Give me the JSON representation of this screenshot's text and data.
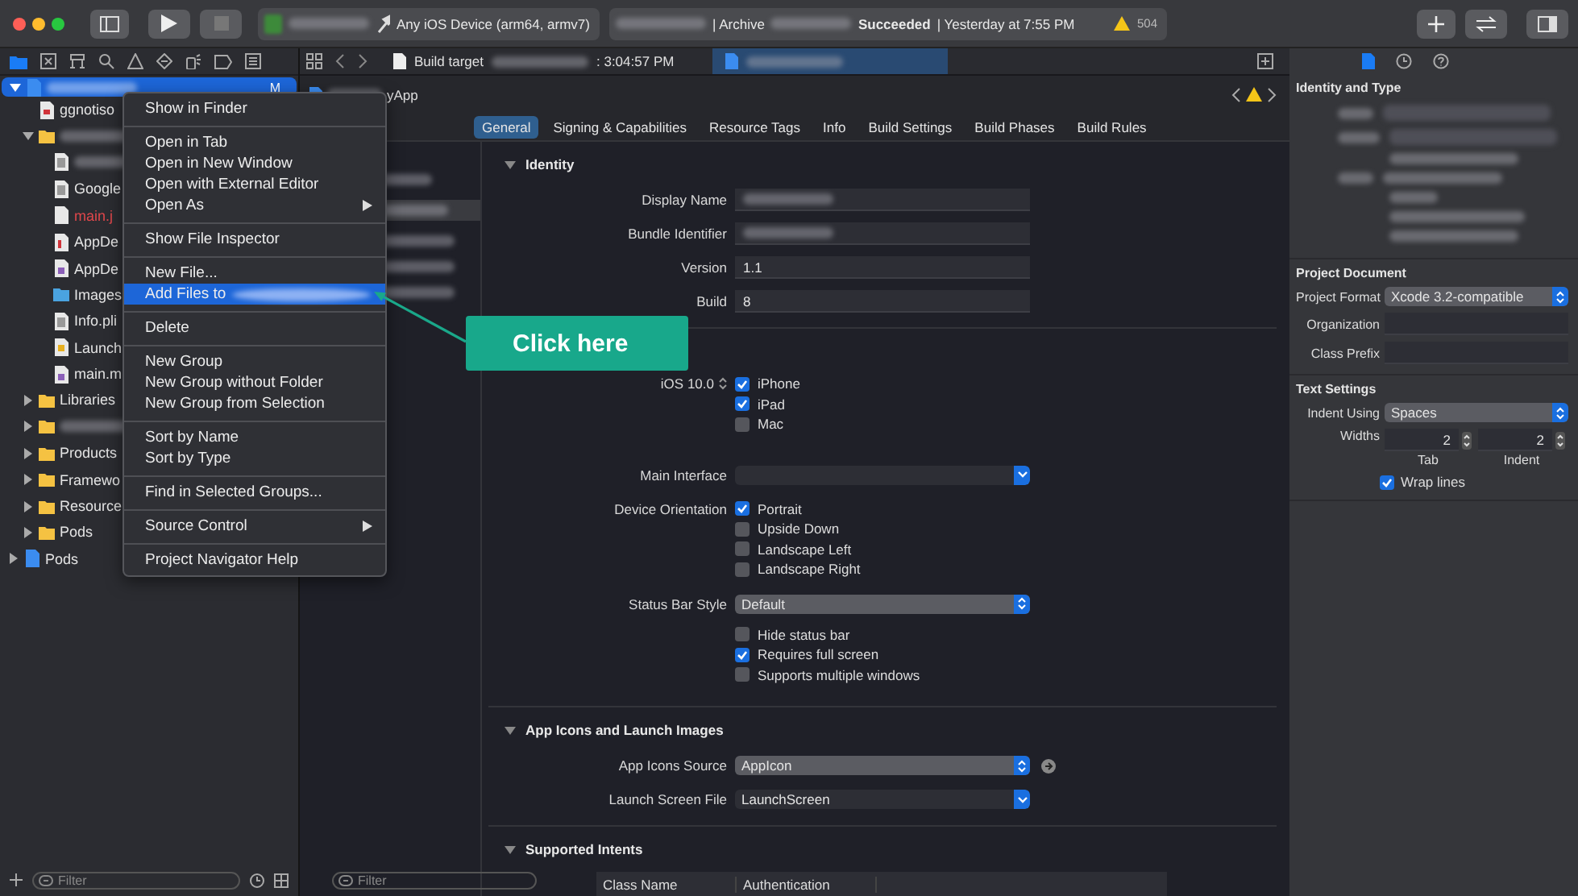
{
  "toolbar": {
    "device": "Any iOS Device (arm64, armv7)",
    "action": "| Archive",
    "status": "Succeeded",
    "time": "| Yesterday at 7:55 PM",
    "warnings": "504"
  },
  "navigator": {
    "tree": [
      {
        "blurred": true,
        "kind": "project",
        "expanded": true,
        "selected": true,
        "missing": false,
        "badge": "M",
        "children": [
          {
            "name": "ggnotiso",
            "kind": "file",
            "selected": false,
            "missing": false
          },
          {
            "blurred": true,
            "kind": "folder",
            "expanded": true,
            "selected": false,
            "missing": false,
            "children": [
              {
                "blurred": true,
                "kind": "plist",
                "selected": false,
                "missing": false
              },
              {
                "name": "Google",
                "kind": "plist",
                "selected": false,
                "missing": false
              },
              {
                "name": "main.j",
                "kind": "file",
                "selected": false,
                "missing": true
              },
              {
                "name": "AppDe",
                "kind": "header",
                "selected": false,
                "missing": false
              },
              {
                "name": "AppDe",
                "kind": "impl",
                "selected": false,
                "missing": false
              },
              {
                "name": "Images",
                "kind": "assets",
                "selected": false,
                "missing": false
              },
              {
                "name": "Info.pli",
                "kind": "plist",
                "selected": false,
                "missing": false
              },
              {
                "name": "Launch",
                "kind": "storyboard",
                "selected": false,
                "missing": false
              },
              {
                "name": "main.m",
                "kind": "impl",
                "selected": false,
                "missing": false
              }
            ]
          },
          {
            "name": "Libraries",
            "kind": "folder",
            "expanded": false,
            "selected": false,
            "missing": false
          },
          {
            "blurred": true,
            "kind": "folder",
            "expanded": false,
            "selected": false,
            "missing": false
          },
          {
            "name": "Products",
            "kind": "folder",
            "expanded": false,
            "selected": false,
            "missing": false
          },
          {
            "name": "Framewo",
            "kind": "folder",
            "expanded": false,
            "selected": false,
            "missing": false
          },
          {
            "name": "Resource",
            "kind": "folder",
            "expanded": false,
            "selected": false,
            "missing": false
          },
          {
            "name": "Pods",
            "kind": "folder",
            "expanded": false,
            "selected": false,
            "missing": false
          }
        ]
      },
      {
        "name": "Pods",
        "kind": "project",
        "expanded": false,
        "selected": false,
        "missing": false
      }
    ],
    "filter_placeholder": "Filter"
  },
  "context_menu": {
    "sections": [
      [
        {
          "label": "Show in Finder",
          "selected": false,
          "submenu": false
        }
      ],
      [
        {
          "label": "Open in Tab",
          "selected": false,
          "submenu": false
        },
        {
          "label": "Open in New Window",
          "selected": false,
          "submenu": false
        },
        {
          "label": "Open with External Editor",
          "selected": false,
          "submenu": false
        },
        {
          "label": "Open As",
          "selected": false,
          "submenu": true
        }
      ],
      [
        {
          "label": "Show File Inspector",
          "selected": false,
          "submenu": false
        }
      ],
      [
        {
          "label": "New File...",
          "selected": false,
          "submenu": false
        },
        {
          "label": "Add Files to",
          "blurred_suffix": true,
          "selected": true,
          "submenu": false
        }
      ],
      [
        {
          "label": "Delete",
          "selected": false,
          "submenu": false
        }
      ],
      [
        {
          "label": "New Group",
          "selected": false,
          "submenu": false
        },
        {
          "label": "New Group without Folder",
          "selected": false,
          "submenu": false
        },
        {
          "label": "New Group from Selection",
          "selected": false,
          "submenu": false
        }
      ],
      [
        {
          "label": "Sort by Name",
          "selected": false,
          "submenu": false
        },
        {
          "label": "Sort by Type",
          "selected": false,
          "submenu": false
        }
      ],
      [
        {
          "label": "Find in Selected Groups...",
          "selected": false,
          "submenu": false
        }
      ],
      [
        {
          "label": "Source Control",
          "selected": false,
          "submenu": true
        }
      ],
      [
        {
          "label": "Project Navigator Help",
          "selected": false,
          "submenu": false
        }
      ]
    ]
  },
  "callout": {
    "label": "Click here"
  },
  "editor_tabs": [
    {
      "label": "Build target",
      "time": ": 3:04:57 PM",
      "selected": false
    },
    {
      "selected": true
    }
  ],
  "jump_bar": {
    "crumb": "yApp"
  },
  "targets": {
    "filter_placeholder": "Filter"
  },
  "settings_tabs": [
    {
      "label": "General",
      "selected": true
    },
    {
      "label": "Signing & Capabilities",
      "selected": false
    },
    {
      "label": "Resource Tags",
      "selected": false
    },
    {
      "label": "Info",
      "selected": false
    },
    {
      "label": "Build Settings",
      "selected": false
    },
    {
      "label": "Build Phases",
      "selected": false
    },
    {
      "label": "Build Rules",
      "selected": false
    }
  ],
  "sections": [
    {
      "title": "Identity",
      "expanded": true,
      "rows": [
        {
          "kind": "field",
          "label": "Display Name",
          "blurred": true
        },
        {
          "kind": "field",
          "label": "Bundle Identifier",
          "blurred": true
        },
        {
          "kind": "field",
          "label": "Version",
          "value": "1.1"
        },
        {
          "kind": "field",
          "label": "Build",
          "value": "8"
        }
      ]
    },
    {
      "rows": [
        {
          "kind": "checks",
          "label": "iOS 10.0",
          "stepper": true,
          "options": [
            {
              "label": "iPhone",
              "checked": true
            },
            {
              "label": "iPad",
              "checked": true
            },
            {
              "label": "Mac",
              "checked": false
            }
          ]
        },
        {
          "kind": "dropdown",
          "label": "Main Interface"
        },
        {
          "kind": "checks",
          "label": "Device Orientation",
          "options": [
            {
              "label": "Portrait",
              "checked": true
            },
            {
              "label": "Upside Down",
              "checked": false
            },
            {
              "label": "Landscape Left",
              "checked": false
            },
            {
              "label": "Landscape Right",
              "checked": false
            }
          ]
        },
        {
          "kind": "popup",
          "label": "Status Bar Style",
          "value": "Default"
        },
        {
          "kind": "checks",
          "options": [
            {
              "label": "Hide status bar",
              "checked": false
            },
            {
              "label": "Requires full screen",
              "checked": true
            },
            {
              "label": "Supports multiple windows",
              "checked": false
            }
          ]
        }
      ]
    },
    {
      "title": "App Icons and Launch Images",
      "expanded": true,
      "rows": [
        {
          "kind": "popup",
          "label": "App Icons Source",
          "value": "AppIcon",
          "go_button": true
        },
        {
          "kind": "dropdown",
          "label": "Launch Screen File",
          "value": "LaunchScreen"
        }
      ]
    },
    {
      "title": "Supported Intents",
      "expanded": true,
      "rows": [
        {
          "kind": "table",
          "columns": [
            "Class Name",
            "Authentication"
          ]
        }
      ]
    }
  ],
  "inspector": {
    "sections": [
      {
        "title": "Identity and Type",
        "blurred": true
      },
      {
        "title": "Project Document",
        "rows": [
          {
            "kind": "popup",
            "label": "Project Format",
            "value": "Xcode 3.2-compatible"
          },
          {
            "kind": "field",
            "label": "Organization"
          },
          {
            "kind": "field",
            "label": "Class Prefix"
          }
        ]
      },
      {
        "title": "Text Settings",
        "rows": [
          {
            "kind": "popup",
            "label": "Indent Using",
            "value": "Spaces"
          },
          {
            "kind": "steppers",
            "label": "Widths",
            "steppers": [
              {
                "value": "2",
                "caption": "Tab"
              },
              {
                "value": "2",
                "caption": "Indent"
              }
            ]
          },
          {
            "kind": "check",
            "label": "Wrap lines",
            "checked": true
          }
        ]
      }
    ]
  }
}
